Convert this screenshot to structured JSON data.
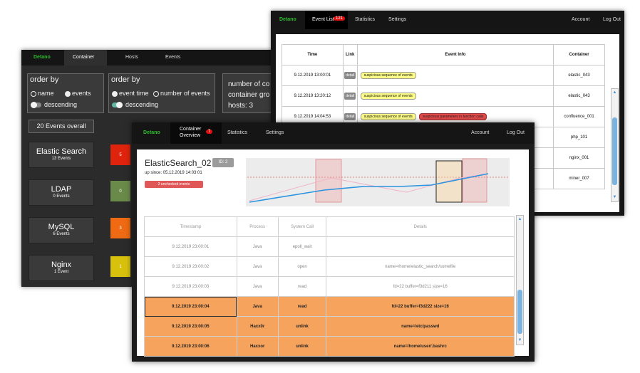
{
  "colors": {
    "brand": "#2dbd2d",
    "badge": "#e01010",
    "highlight": "#f6a35e",
    "detail_tag": "#ffff88",
    "alert_tag": "#e54a4a"
  },
  "w1": {
    "nav": {
      "brand": "Detano",
      "container": "Container",
      "hosts": "Hosts",
      "events": "Events"
    },
    "order1": {
      "title": "order by",
      "name": "name",
      "events": "events",
      "descending": "descending"
    },
    "order2": {
      "title": "order by",
      "event_time": "event time",
      "number_of_events": "number of events",
      "descending": "descending"
    },
    "info": {
      "line1": "number of co",
      "line2": "container gro",
      "line3": "hosts: 3"
    },
    "events_overall": "20 Events overall",
    "containers": [
      {
        "name": "Elastic Search",
        "count": "13 Events",
        "square_value": "5",
        "square_color": "#e0230d"
      },
      {
        "name": "LDAP",
        "count": "0 Events",
        "square_value": "0",
        "square_color": "#6a8a4a"
      },
      {
        "name": "MySQL",
        "count": "6 Events",
        "square_value": "3",
        "square_color": "#ef6a12"
      },
      {
        "name": "Nginx",
        "count": "1 Event",
        "square_value": "1",
        "square_color": "#d8c10c"
      }
    ]
  },
  "w2": {
    "nav": {
      "brand": "Detano",
      "event_list": "Event List",
      "badge": "121",
      "statistics": "Statistics",
      "settings": "Settings",
      "account": "Account",
      "logout": "Log Out"
    },
    "headers": [
      "Time",
      "Link",
      "Event Info",
      "Container"
    ],
    "detail_label": "detail",
    "rows": [
      {
        "time": "9.12.2019 13:00:01",
        "tags": [
          "suspicious sequence of events"
        ],
        "alert": "",
        "container": "elastic_043"
      },
      {
        "time": "9.12.2019 13:20:12",
        "tags": [
          "suspicious sequence of events"
        ],
        "alert": "",
        "container": "elastic_043"
      },
      {
        "time": "9.12.2019 14:04:53",
        "tags": [
          "suspicious sequence of events"
        ],
        "alert": "suspicious parameters in function calls",
        "container": "confluence_001"
      },
      {
        "time": "",
        "tags": [],
        "alert": "",
        "container": "php_101"
      },
      {
        "time": "",
        "tags": [],
        "alert": "",
        "container": "nginx_001"
      },
      {
        "time": "",
        "tags": [],
        "alert": "",
        "container": "miner_007"
      }
    ]
  },
  "w3": {
    "nav": {
      "brand": "Detano",
      "overview_line1": "Container",
      "overview_line2": "Overview",
      "badge": "7",
      "statistics": "Statistics",
      "settings": "Settings",
      "account": "Account",
      "logout": "Log Out"
    },
    "title": "ElasticSearch_02",
    "id_label": "ID: 2",
    "up_since": "up since: 05.12.2019 14:03:01",
    "unchecked": "2 unchecked events",
    "headers": [
      "Timestamp",
      "Process",
      "System Call",
      "Details"
    ],
    "rows": [
      {
        "ts": "9.12.2019 23:00:01",
        "process": "Java",
        "syscall": "epoll_wait",
        "details": "",
        "highlight": false
      },
      {
        "ts": "9.12.2019 23:00:02",
        "process": "Java",
        "syscall": "open",
        "details": "name=/home/elastic_search/somefile",
        "highlight": false
      },
      {
        "ts": "9.12.2019 23:00:03",
        "process": "Java",
        "syscall": "read",
        "details": "fd=22 buffer=f3d211 size=16",
        "highlight": false
      },
      {
        "ts": "9.12.2019 23:00:04",
        "process": "Java",
        "syscall": "read",
        "details": "fd=22 buffer=f3d222 size=16",
        "highlight": true
      },
      {
        "ts": "9.12.2019 23:00:05",
        "process": "Haxx0r",
        "syscall": "unlink",
        "details": "name=/etc/passwd",
        "highlight": true
      },
      {
        "ts": "9.12.2019 23:00:06",
        "process": "Haxxor",
        "syscall": "unlink",
        "details": "name=/home/user/.bashrc",
        "highlight": true
      }
    ]
  }
}
